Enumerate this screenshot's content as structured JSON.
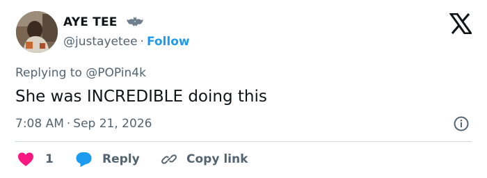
{
  "author": {
    "display_name": "AYE TEE",
    "badge_emoji": "bat-emoji",
    "handle": "@justayetee",
    "follow_label": "Follow",
    "separator": "·"
  },
  "brand": {
    "logo_icon": "x-logo-icon"
  },
  "tweet": {
    "replying_to": "Replying to @POPin4k",
    "text": "She was INCREDIBLE doing this",
    "time": "7:08 AM",
    "date": "Sep 21, 2026"
  },
  "actions": {
    "like_count": "1",
    "reply_label": "Reply",
    "copy_label": "Copy link"
  },
  "colors": {
    "text": "#0f1419",
    "secondary_text": "#536471",
    "link_blue": "#1d9bf0",
    "like_pink": "#f91880",
    "divider": "#cfd9de"
  }
}
